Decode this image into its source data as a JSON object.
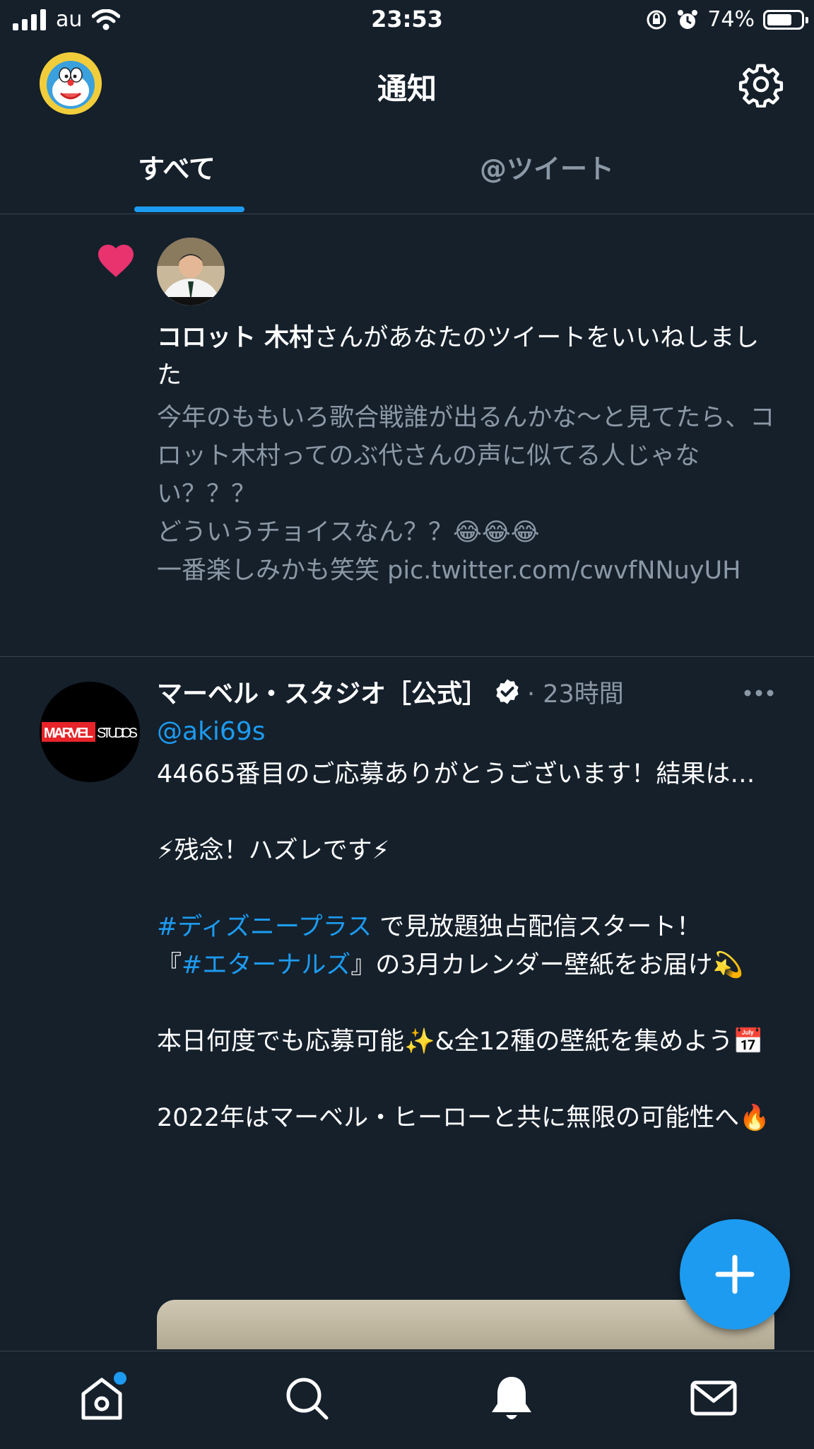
{
  "status_bar": {
    "carrier": "au",
    "time": "23:53",
    "battery_percent": "74%",
    "battery_level": 0.74,
    "icons": [
      "signal-icon",
      "wifi-icon",
      "rotation-lock-icon",
      "alarm-icon",
      "battery-icon"
    ]
  },
  "header": {
    "title": "通知",
    "icons": [
      "profile-avatar",
      "gear-icon"
    ]
  },
  "tabs": [
    {
      "label": "すべて",
      "active": true
    },
    {
      "label": "@ツイート",
      "active": false
    }
  ],
  "like_notification": {
    "icon": "heart-icon",
    "actor_name": "コロット 木村",
    "action_text": "さんがあなたのツイートをいいねしました",
    "tweet_text": "今年のももいろ歌合戦誰が出るんかな〜と見てたら、コロット木村ってのぶ代さんの声に似てる人じゃない？？？\nどういうチョイスなん？？😂😂😂\n一番楽しみかも笑笑 pic.twitter.com/cwvfNNuyUH"
  },
  "tweet": {
    "author_name": "マーベル・スタジオ［公式］",
    "time": "· 23時間",
    "reply_handle": "@aki69s",
    "avatar_text": "MARVEL STUDIOS",
    "line1": "44665番目のご応募ありがとうございます！結果は…",
    "line2": "⚡残念！ハズレです⚡",
    "hashtag1": "#ディズニープラス",
    "line3_rest": " で見放題独占配信スタート！",
    "line4_prefix": "『",
    "hashtag2": "#エターナルズ",
    "line4_rest": "』の3月カレンダー壁紙をお届け💫",
    "line5": "本日何度でも応募可能✨&全12種の壁紙を集めよう📅",
    "line6": "2022年はマーベル・ヒーローと共に無限の可能性へ🔥"
  },
  "fab": {
    "icon": "plus-icon"
  },
  "bottom_nav": [
    {
      "icon": "home-icon",
      "has_badge": true
    },
    {
      "icon": "search-icon"
    },
    {
      "icon": "bell-icon",
      "active": true
    },
    {
      "icon": "mail-icon"
    }
  ],
  "colors": {
    "background": "#15202b",
    "accent": "#1d9bf0",
    "heart": "#e8336f",
    "secondary_text": "#8b98a5",
    "divider": "#38444d"
  }
}
